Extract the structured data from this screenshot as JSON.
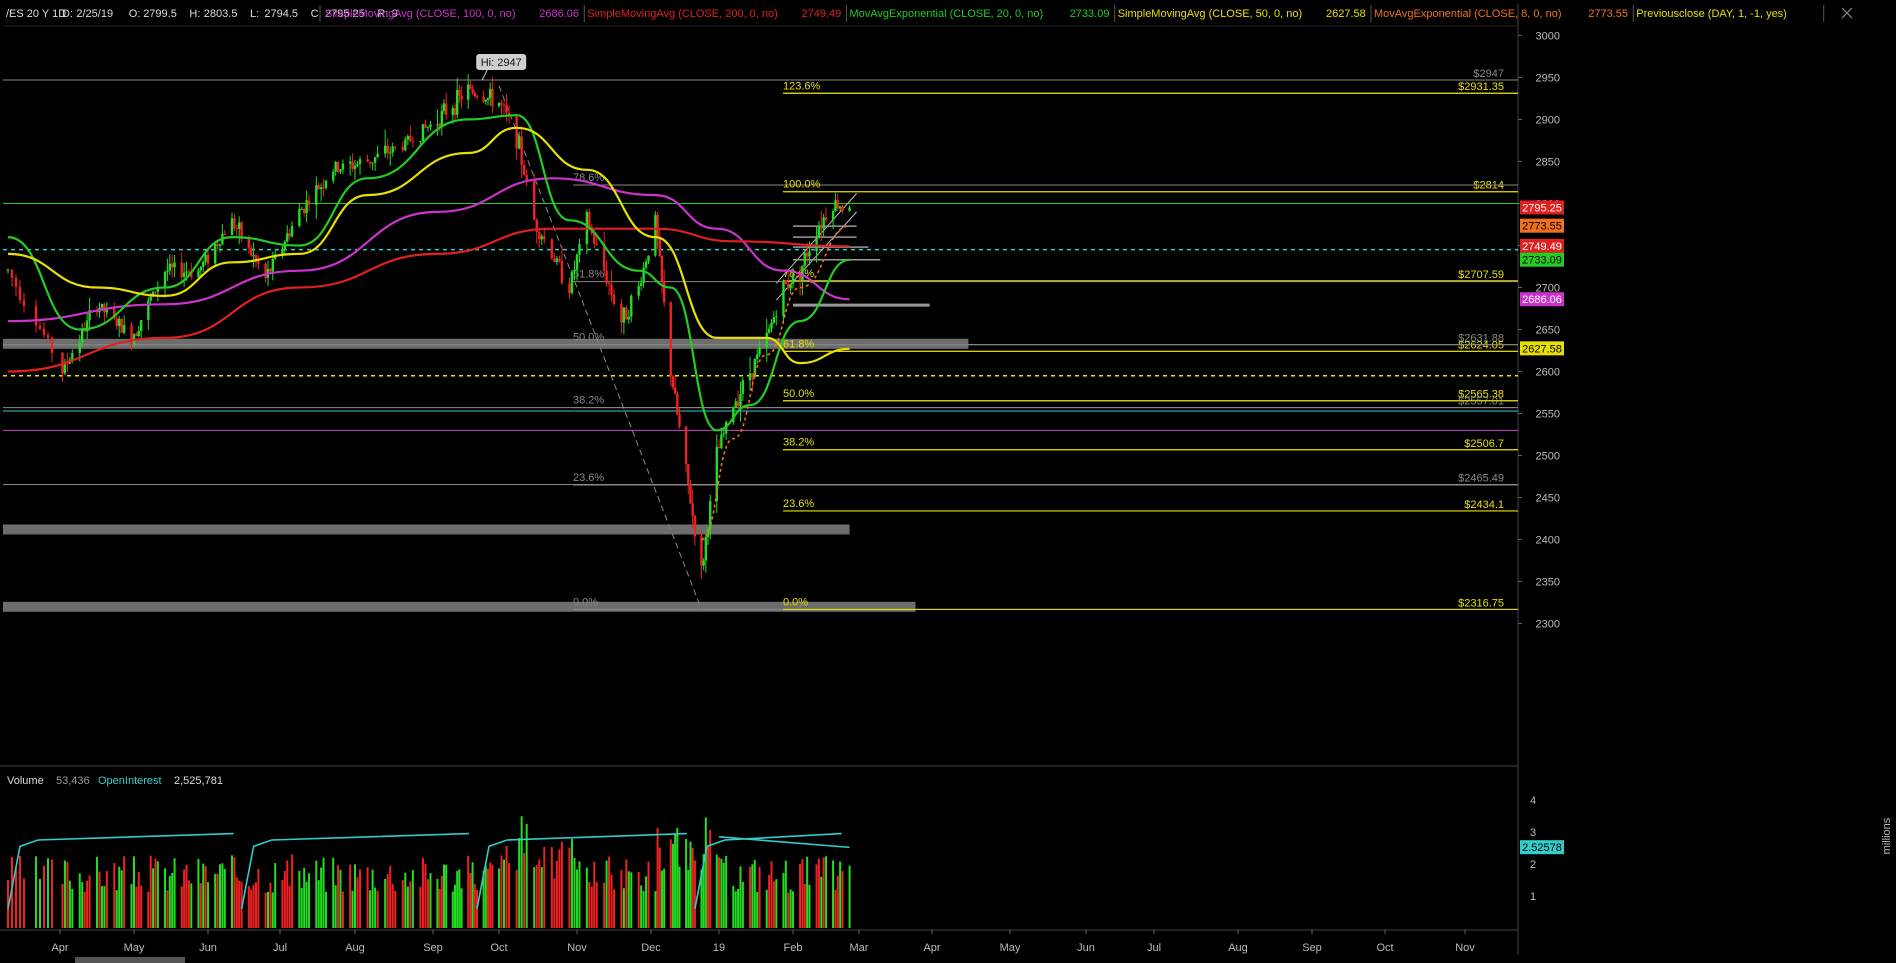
{
  "header": {
    "symbol": "/ES 20 Y 1D",
    "ohlc": [
      {
        "label": "D:",
        "value": "2/25/19"
      },
      {
        "label": "O:",
        "value": "2799.5"
      },
      {
        "label": "H:",
        "value": "2803.5"
      },
      {
        "label": "L:",
        "value": "2794.5"
      },
      {
        "label": "C:",
        "value": "2795.25"
      },
      {
        "label": "R:",
        "value": "9"
      }
    ],
    "studies": [
      {
        "name": "SimpleMovingAvg (CLOSE, 100, 0, no)",
        "value": "2686.06",
        "color": "#cc33cc"
      },
      {
        "name": "SimpleMovingAvg (CLOSE, 200, 0, no)",
        "value": "2749.49",
        "color": "#e02020"
      },
      {
        "name": "MovAvgExponential (CLOSE, 20, 0, no)",
        "value": "2733.09",
        "color": "#22cc22"
      },
      {
        "name": "SimpleMovingAvg (CLOSE, 50, 0, no)",
        "value": "2627.58",
        "color": "#e8e000"
      },
      {
        "name": "MovAvgExponential (CLOSE, 8, 0, no)",
        "value": "2773.55",
        "color": "#f07020"
      },
      {
        "name": "Previousclose (DAY, 1, -1, yes)",
        "value": "",
        "color": "#e8e000"
      }
    ]
  },
  "chart_data": {
    "type": "candlestick",
    "symbol": "/ES",
    "timeframe": "20 Y 1D",
    "ylim": [
      2290,
      3010
    ],
    "y_ticks": [
      2300,
      2350,
      2400,
      2450,
      2500,
      2550,
      2600,
      2650,
      2700,
      2750,
      2800,
      2850,
      2900,
      2950,
      3000
    ],
    "x_tick_labels": [
      "Apr",
      "May",
      "Jun",
      "Jul",
      "Aug",
      "Sep",
      "Oct",
      "Nov",
      "Dec",
      "19",
      "Feb",
      "Mar",
      "Apr",
      "May",
      "Jun",
      "Jul",
      "Aug",
      "Sep",
      "Oct",
      "Nov"
    ],
    "price_path": [
      [
        "2018-03-19",
        2720
      ],
      [
        "2018-04-02",
        2600
      ],
      [
        "2018-04-16",
        2680
      ],
      [
        "2018-04-30",
        2640
      ],
      [
        "2018-05-14",
        2720
      ],
      [
        "2018-05-28",
        2720
      ],
      [
        "2018-06-11",
        2780
      ],
      [
        "2018-06-25",
        2710
      ],
      [
        "2018-07-09",
        2790
      ],
      [
        "2018-07-23",
        2840
      ],
      [
        "2018-08-06",
        2850
      ],
      [
        "2018-08-20",
        2870
      ],
      [
        "2018-09-03",
        2900
      ],
      [
        "2018-09-17",
        2935
      ],
      [
        "2018-10-01",
        2920
      ],
      [
        "2018-10-08",
        2880
      ],
      [
        "2018-10-15",
        2780
      ],
      [
        "2018-10-29",
        2700
      ],
      [
        "2018-11-05",
        2780
      ],
      [
        "2018-11-19",
        2660
      ],
      [
        "2018-11-26",
        2700
      ],
      [
        "2018-12-03",
        2780
      ],
      [
        "2018-12-10",
        2600
      ],
      [
        "2018-12-17",
        2480
      ],
      [
        "2018-12-24",
        2360
      ],
      [
        "2018-12-31",
        2500
      ],
      [
        "2019-01-07",
        2560
      ],
      [
        "2019-01-14",
        2600
      ],
      [
        "2019-01-21",
        2640
      ],
      [
        "2019-01-28",
        2700
      ],
      [
        "2019-02-04",
        2720
      ],
      [
        "2019-02-11",
        2770
      ],
      [
        "2019-02-18",
        2800
      ],
      [
        "2019-02-25",
        2795
      ]
    ],
    "last_ohlc": {
      "date": "2/25/19",
      "open": 2799.5,
      "high": 2803.5,
      "low": 2794.5,
      "close": 2795.25
    },
    "hi_label": "Hi: 2947",
    "moving_averages": [
      {
        "name": "SMA 100",
        "color": "#cc33cc",
        "last": 2686.06,
        "path": [
          [
            "2018-03-19",
            2660
          ],
          [
            "2018-05-14",
            2680
          ],
          [
            "2018-07-09",
            2720
          ],
          [
            "2018-09-03",
            2790
          ],
          [
            "2018-10-22",
            2830
          ],
          [
            "2018-12-03",
            2810
          ],
          [
            "2018-12-31",
            2770
          ],
          [
            "2019-01-28",
            2720
          ],
          [
            "2019-02-25",
            2686
          ]
        ]
      },
      {
        "name": "SMA 200",
        "color": "#e02020",
        "last": 2749.49,
        "path": [
          [
            "2018-03-19",
            2600
          ],
          [
            "2018-05-14",
            2640
          ],
          [
            "2018-07-09",
            2700
          ],
          [
            "2018-09-03",
            2740
          ],
          [
            "2018-10-22",
            2770
          ],
          [
            "2018-12-03",
            2770
          ],
          [
            "2019-01-07",
            2755
          ],
          [
            "2019-02-25",
            2749
          ]
        ]
      },
      {
        "name": "EMA 20",
        "color": "#22cc22",
        "last": 2733.09,
        "path": [
          [
            "2018-03-19",
            2760
          ],
          [
            "2018-04-09",
            2650
          ],
          [
            "2018-05-14",
            2700
          ],
          [
            "2018-06-11",
            2760
          ],
          [
            "2018-07-09",
            2750
          ],
          [
            "2018-08-06",
            2830
          ],
          [
            "2018-09-17",
            2900
          ],
          [
            "2018-10-08",
            2905
          ],
          [
            "2018-10-29",
            2780
          ],
          [
            "2018-11-26",
            2720
          ],
          [
            "2018-12-10",
            2700
          ],
          [
            "2018-12-31",
            2530
          ],
          [
            "2019-01-14",
            2560
          ],
          [
            "2019-02-04",
            2660
          ],
          [
            "2019-02-25",
            2733
          ]
        ]
      },
      {
        "name": "SMA 50",
        "color": "#e8e000",
        "last": 2627.58,
        "path": [
          [
            "2018-03-19",
            2740
          ],
          [
            "2018-04-16",
            2700
          ],
          [
            "2018-05-14",
            2690
          ],
          [
            "2018-06-11",
            2730
          ],
          [
            "2018-07-09",
            2740
          ],
          [
            "2018-08-06",
            2810
          ],
          [
            "2018-09-17",
            2860
          ],
          [
            "2018-10-08",
            2890
          ],
          [
            "2018-11-05",
            2840
          ],
          [
            "2018-12-03",
            2760
          ],
          [
            "2018-12-31",
            2640
          ],
          [
            "2019-01-21",
            2640
          ],
          [
            "2019-02-04",
            2610
          ],
          [
            "2019-02-25",
            2627
          ]
        ]
      },
      {
        "name": "EMA 8",
        "color": "#f07020",
        "last": 2773.55,
        "path": [
          [
            "2018-12-24",
            2400
          ],
          [
            "2019-01-07",
            2520
          ],
          [
            "2019-01-21",
            2620
          ],
          [
            "2019-02-04",
            2700
          ],
          [
            "2019-02-25",
            2773
          ]
        ]
      }
    ],
    "horizontal_lines": [
      {
        "y": 2947,
        "label": "$2947",
        "color": "#888888"
      },
      {
        "y": 2931.35,
        "label": "$2931.35",
        "color": "#e8e000"
      },
      {
        "y": 2814,
        "label": "$2814",
        "color": "#e8e000"
      },
      {
        "y": 2800,
        "label": "",
        "color": "#22cc22"
      },
      {
        "y": 2745,
        "label": "",
        "color": "#33cccc",
        "dashed": true
      },
      {
        "y": 2707.59,
        "label": "$2707.59",
        "color": "#e8e000"
      },
      {
        "y": 2631.88,
        "label": "$2631.88",
        "color": "#888888"
      },
      {
        "y": 2624.05,
        "label": "$2624.05",
        "color": "#e8e000"
      },
      {
        "y": 2595,
        "label": "",
        "color": "#e8e000",
        "dashed": true
      },
      {
        "y": 2565.38,
        "label": "$2565.38",
        "color": "#e8e000"
      },
      {
        "y": 2557.01,
        "label": "$2557.01",
        "color": "#888888"
      },
      {
        "y": 2553,
        "label": "",
        "color": "#33cccc"
      },
      {
        "y": 2530,
        "label": "",
        "color": "#cc44cc"
      },
      {
        "y": 2506.7,
        "label": "$2506.7",
        "color": "#e8e000"
      },
      {
        "y": 2465.49,
        "label": "$2465.49",
        "color": "#888888"
      },
      {
        "y": 2434.1,
        "label": "$2434.1",
        "color": "#e8e000"
      },
      {
        "y": 2316.75,
        "label": "$2316.75",
        "color": "#e8e000"
      }
    ],
    "zones": [
      {
        "y": 2633,
        "from": "2018-03-19",
        "to": "2019-04-15"
      },
      {
        "y": 2412,
        "from": "2018-03-19",
        "to": "2019-02-25"
      },
      {
        "y": 2320,
        "from": "2018-03-19",
        "to": "2019-03-25"
      }
    ],
    "fib_sets": [
      {
        "color": "#888888",
        "levels": [
          {
            "label": "78.6%",
            "y": 2822
          },
          {
            "label": "61.8%",
            "y": 2707
          },
          {
            "label": "50.0%",
            "y": 2632
          },
          {
            "label": "38.2%",
            "y": 2557
          },
          {
            "label": "23.6%",
            "y": 2465
          },
          {
            "label": "0.0%",
            "y": 2317
          }
        ]
      },
      {
        "color": "#e8e000",
        "levels": [
          {
            "label": "123.6%",
            "y": 2931
          },
          {
            "label": "100.0%",
            "y": 2814
          },
          {
            "label": "78.6%",
            "y": 2708
          },
          {
            "label": "61.8%",
            "y": 2624
          },
          {
            "label": "50.0%",
            "y": 2565
          },
          {
            "label": "38.2%",
            "y": 2507
          },
          {
            "label": "23.6%",
            "y": 2434
          },
          {
            "label": "0.0%",
            "y": 2317
          }
        ]
      }
    ],
    "price_tags": [
      {
        "value": "2795.25",
        "y": 2795.25,
        "bg": "#e02020",
        "fg": "#ffffff"
      },
      {
        "value": "2773.55",
        "y": 2773.55,
        "bg": "#f07020",
        "fg": "#000000"
      },
      {
        "value": "2749.49",
        "y": 2749.49,
        "bg": "#e02020",
        "fg": "#ffffff"
      },
      {
        "value": "2733.09",
        "y": 2733.09,
        "bg": "#22cc22",
        "fg": "#000000"
      },
      {
        "value": "2686.06",
        "y": 2686.06,
        "bg": "#cc33cc",
        "fg": "#ffffff"
      },
      {
        "value": "2627.58",
        "y": 2627.58,
        "bg": "#e8e000",
        "fg": "#000000"
      }
    ],
    "volume": {
      "label": "Volume",
      "value": "53,436",
      "oi_label": "OpenInterest",
      "oi_value": "2,525,781",
      "oi_tag": "2.52578",
      "unit_label": "millions",
      "ylim": [
        0,
        4
      ],
      "y_ticks": [
        1,
        2,
        3,
        4
      ]
    }
  }
}
